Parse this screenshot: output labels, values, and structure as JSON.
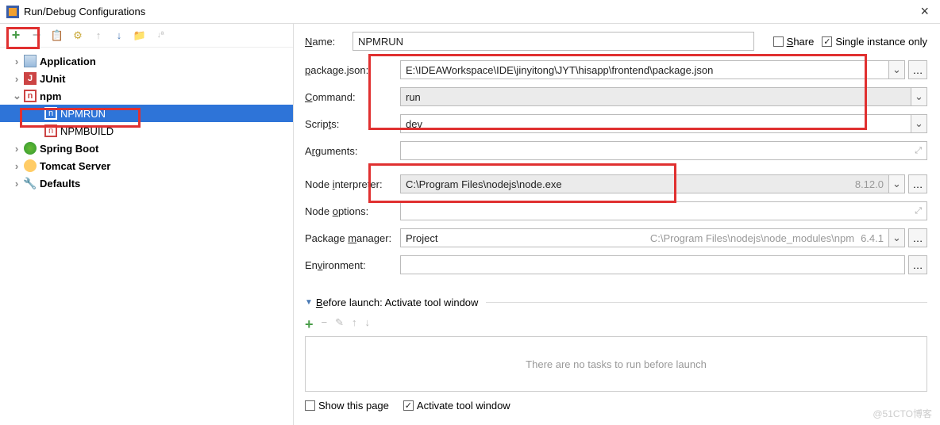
{
  "title": "Run/Debug Configurations",
  "sidebar": {
    "items": [
      {
        "label": "Application"
      },
      {
        "label": "JUnit"
      },
      {
        "label": "npm"
      },
      {
        "label": "Spring Boot"
      },
      {
        "label": "Tomcat Server"
      },
      {
        "label": "Defaults"
      }
    ],
    "npm_children": [
      {
        "label": "NPMRUN"
      },
      {
        "label": "NPMBUILD"
      }
    ]
  },
  "form": {
    "name_label": "Name:",
    "name_value": "NPMRUN",
    "share_label": "Share",
    "single_label": "Single instance only",
    "package_label": "package.json:",
    "package_value": "E:\\IDEAWorkspace\\IDE\\jinyitong\\JYT\\hisapp\\frontend\\package.json",
    "command_label": "Command:",
    "command_value": "run",
    "scripts_label": "Scripts:",
    "scripts_value": "dev",
    "arguments_label": "Arguments:",
    "arguments_value": "",
    "node_interp_label": "Node interpreter:",
    "node_interp_value": "C:\\Program Files\\nodejs\\node.exe",
    "node_interp_ver": "8.12.0",
    "node_opts_label": "Node options:",
    "node_opts_value": "",
    "pkg_mgr_label": "Package manager:",
    "pkg_mgr_value": "Project",
    "pkg_mgr_path": "C:\\Program Files\\nodejs\\node_modules\\npm",
    "pkg_mgr_ver": "6.4.1",
    "env_label": "Environment:",
    "env_value": "",
    "before_label": "Before launch: Activate tool window",
    "no_tasks": "There are no tasks to run before launch",
    "show_page": "Show this page",
    "activate_tw": "Activate tool window"
  },
  "watermark": "@51CTO博客"
}
